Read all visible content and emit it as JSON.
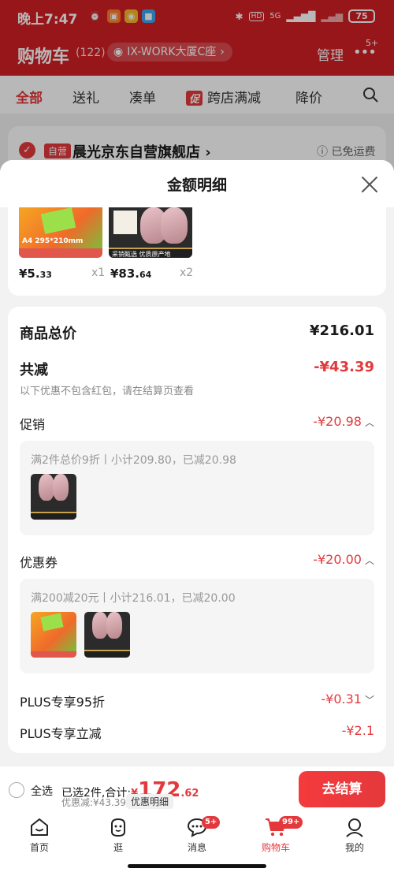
{
  "status_bar": {
    "time": "晚上7:47",
    "battery": "75",
    "network": "5G"
  },
  "cart_header": {
    "title": "购物车",
    "count": "(122)",
    "address": "IX-WORK大厦C座",
    "manage": "管理",
    "more_badge": "5+"
  },
  "tabs": [
    {
      "label": "全部",
      "active": true
    },
    {
      "label": "送礼"
    },
    {
      "label": "凑单"
    },
    {
      "label": "跨店满减",
      "tag": "促"
    },
    {
      "label": "降价"
    }
  ],
  "shop": {
    "self_tag": "自营",
    "name": "晨光京东自营旗舰店 ›",
    "shipping": "已免运费"
  },
  "sheet": {
    "title": "金额明细"
  },
  "products": [
    {
      "price_int": "¥5.",
      "price_dec": "33",
      "qty": "x1",
      "thumb": "notebook",
      "thumb_text": "A4 295*210mm"
    },
    {
      "price_int": "¥83.",
      "price_dec": "64",
      "qty": "x2",
      "thumb": "meat",
      "thumb_text": "采销甄选 优质原产地"
    }
  ],
  "detail": {
    "total_label": "商品总价",
    "total_value": "¥216.01",
    "reduce_label": "共减",
    "reduce_value": "-¥43.39",
    "reduce_note": "以下优惠不包含红包，请在结算页查看",
    "promo_label": "促销",
    "promo_value": "-¥20.98",
    "promo_desc": "满2件总价9折丨小计209.80，已减20.98",
    "coupon_label": "优惠券",
    "coupon_value": "-¥20.00",
    "coupon_desc": "满200减20元丨小计216.01，已减20.00",
    "plus95_label": "PLUS专享95折",
    "plus95_value": "-¥0.31",
    "plusdirect_label": "PLUS专享立减",
    "plusdirect_value": "-¥2.1"
  },
  "checkout": {
    "select_all": "全选",
    "selected_text": "已选2件,合计:",
    "currency": "¥",
    "total_int": "172",
    "total_dec": ".62",
    "savings": "优惠减:¥43.39",
    "detail_chip": "优惠明细",
    "button": "去结算"
  },
  "bottom_nav": [
    {
      "label": "首页",
      "icon": "home-icon"
    },
    {
      "label": "逛",
      "icon": "browse-icon"
    },
    {
      "label": "消息",
      "icon": "message-icon",
      "badge": "5+"
    },
    {
      "label": "购物车",
      "icon": "cart-icon",
      "badge": "99+",
      "active": true
    },
    {
      "label": "我的",
      "icon": "profile-icon"
    }
  ],
  "colors": {
    "brand_red": "#e4393c",
    "header_red": "#d21f24",
    "bg": "#f2f2f2"
  }
}
